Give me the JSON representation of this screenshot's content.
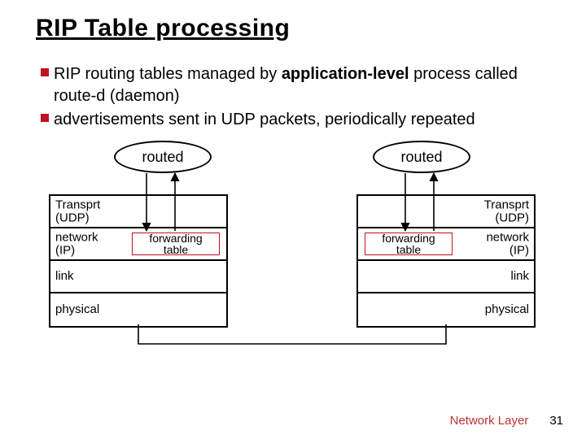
{
  "title": "RIP Table processing",
  "bullets": [
    {
      "pre": "RIP routing tables managed by ",
      "strong": "application-level",
      "post": " process called route-d (daemon)"
    },
    {
      "pre": "advertisements sent in UDP packets, periodically repeated",
      "strong": "",
      "post": ""
    }
  ],
  "diagram": {
    "routed_label": "routed",
    "layers": {
      "transport": {
        "l1": "Transprt",
        "l2": "(UDP)"
      },
      "network": {
        "l1": "network",
        "l2": "(IP)"
      },
      "link": "link",
      "physical": "physical"
    },
    "forwarding": {
      "l1": "forwarding",
      "l2": "table"
    }
  },
  "footer": {
    "chapter": "Network Layer",
    "page": "31"
  }
}
